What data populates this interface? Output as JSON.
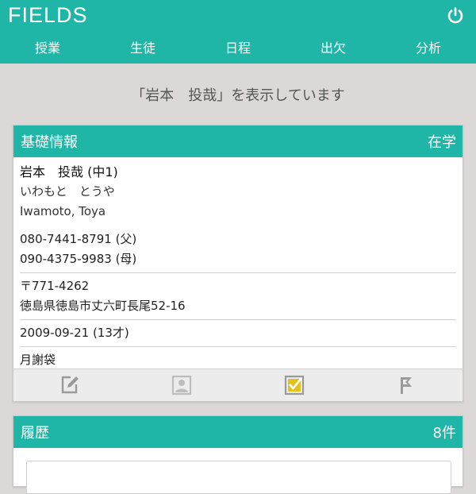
{
  "app": {
    "logo": "FIELDS"
  },
  "nav": [
    "授業",
    "生徒",
    "日程",
    "出欠",
    "分析"
  ],
  "status_message": "「岩本　投哉」を表示しています",
  "basic_info": {
    "title": "基礎情報",
    "status": "在学",
    "name_line": "岩本　投哉 (中1)",
    "kana": "いわもと　とうや",
    "romaji": "Iwamoto, Toya",
    "phone_father": "080-7441-8791 (父)",
    "phone_mother": "090-4375-9983 (母)",
    "postal": "〒771-4262",
    "address": "徳島県徳島市丈六町長尾52-16",
    "birthday": "2009-09-21 (13才)",
    "payment": "月謝袋"
  },
  "actions": [
    {
      "icon": "edit-icon"
    },
    {
      "icon": "contact-icon"
    },
    {
      "icon": "checkbox-icon"
    },
    {
      "icon": "flag-icon"
    }
  ],
  "history": {
    "title": "履歴",
    "count": "8件"
  },
  "colors": {
    "accent": "#1fb5a7",
    "background": "#dcd8d8",
    "icon_gray": "#9a9a9a",
    "icon_yellow": "#e0c21a"
  }
}
